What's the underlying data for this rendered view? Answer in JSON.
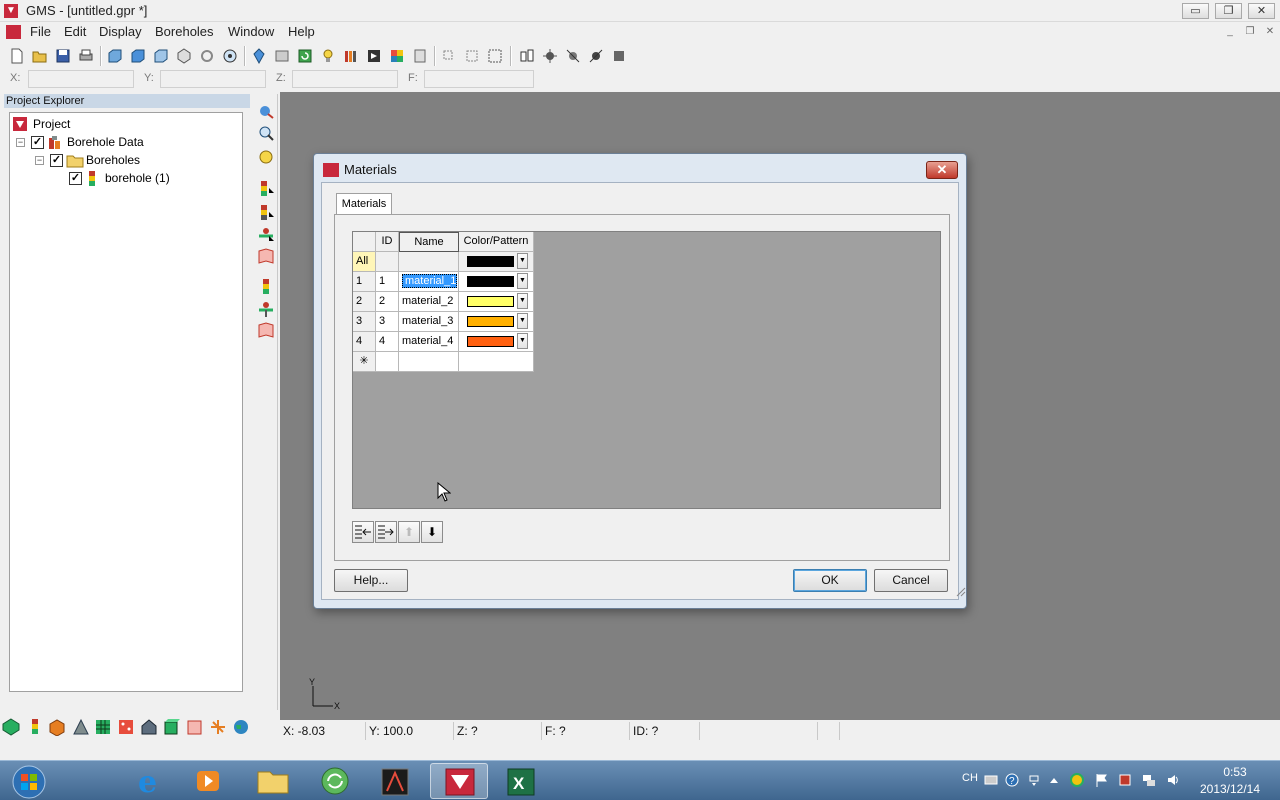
{
  "window": {
    "title": "GMS - [untitled.gpr *]",
    "minimize_glyph": "▭",
    "restore_glyph": "❐",
    "close_glyph": "✕"
  },
  "menu": [
    "File",
    "Edit",
    "Display",
    "Boreholes",
    "Window",
    "Help"
  ],
  "mdi_controls": [
    "_",
    "❐",
    "✕"
  ],
  "coords": {
    "x_label": "X:",
    "y_label": "Y:",
    "z_label": "Z:",
    "f_label": "F:"
  },
  "project_explorer": {
    "header": "Project Explorer",
    "tree": [
      {
        "label": "Project",
        "level": 0,
        "expander": "",
        "checked": false,
        "icon": "project-icon"
      },
      {
        "label": "Borehole Data",
        "level": 1,
        "expander": "−",
        "checked": true,
        "icon": "borehole-data-icon"
      },
      {
        "label": "Boreholes",
        "level": 2,
        "expander": "−",
        "checked": true,
        "icon": "folder-icon"
      },
      {
        "label": "borehole (1)",
        "level": 3,
        "expander": "",
        "checked": true,
        "icon": "borehole-icon"
      }
    ]
  },
  "status_bar": {
    "x": "X: -8.03",
    "y": "Y: 100.0",
    "z": "Z: ?",
    "f": "F: ?",
    "id": "ID: ?"
  },
  "axis_triad": {
    "y": "Y",
    "x": "X"
  },
  "dialog": {
    "title": "Materials",
    "tab": "Materials",
    "columns": [
      "ID",
      "Name",
      "Color/Pattern"
    ],
    "all_row_label": "All",
    "all_color": "#000000",
    "rows": [
      {
        "row": "1",
        "id": "1",
        "name": "material_1",
        "color": "#000000",
        "selected": true
      },
      {
        "row": "2",
        "id": "2",
        "name": "material_2",
        "color": "#ffff66",
        "selected": false
      },
      {
        "row": "3",
        "id": "3",
        "name": "material_3",
        "color": "#ffb000",
        "selected": false
      },
      {
        "row": "4",
        "id": "4",
        "name": "material_4",
        "color": "#ff6010",
        "selected": false
      }
    ],
    "new_row_marker": "✳",
    "grid_buttons": {
      "move_up_glyph": "⬆",
      "move_down_glyph": "⬇"
    },
    "help_button": "Help...",
    "ok_button": "OK",
    "cancel_button": "Cancel"
  },
  "taskbar": {
    "lang": "CH",
    "time": "0:53",
    "date": "2013/12/14"
  },
  "colors": {
    "graphics_bg": "#808080",
    "grid_bg": "#a0a0a0",
    "selection": "#3399ff",
    "gms_red": "#c8283c"
  }
}
